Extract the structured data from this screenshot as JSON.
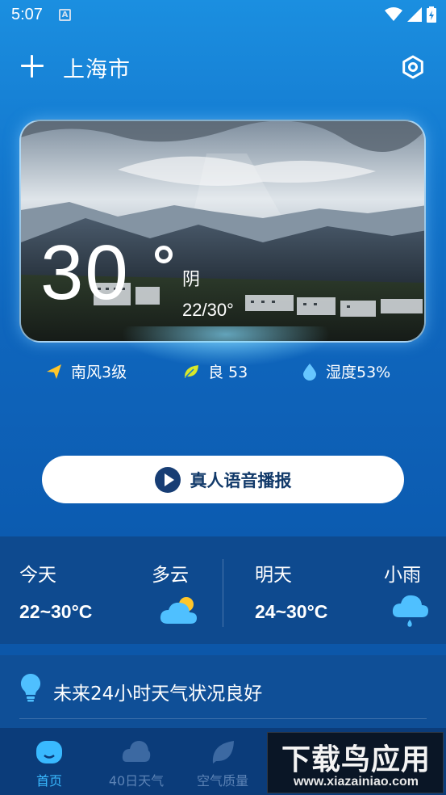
{
  "status_bar": {
    "time": "5:07",
    "notification_icon_letter": "A"
  },
  "header": {
    "city": "上海市",
    "add_icon": "plus-icon",
    "settings_icon": "hexagon-settings-icon"
  },
  "current": {
    "temperature": "30",
    "condition": "阴",
    "range": "22/30°"
  },
  "indicators": {
    "wind": "南风3级",
    "air_quality": "良 53",
    "humidity": "湿度53%"
  },
  "voice_button": {
    "label": "真人语音播报"
  },
  "forecast": {
    "today": {
      "day": "今天",
      "condition": "多云",
      "temp": "22~30°C",
      "icon": "partly-cloudy-icon"
    },
    "tomorrow": {
      "day": "明天",
      "condition": "小雨",
      "temp": "24~30°C",
      "icon": "light-rain-icon"
    }
  },
  "tip": {
    "text": "未来24小时天气状况良好"
  },
  "nav": {
    "items": [
      {
        "label": "首页",
        "icon": "home-icon",
        "active": true
      },
      {
        "label": "40日天气",
        "icon": "calendar-cloud-icon",
        "active": false
      },
      {
        "label": "空气质量",
        "icon": "leaf-icon",
        "active": false
      }
    ]
  },
  "watermark": {
    "title": "下载鸟应用",
    "url": "www.xiazainiao.com"
  },
  "colors": {
    "accent": "#39b9ff",
    "button_text": "#123a6a",
    "sun": "#ffc62a"
  }
}
